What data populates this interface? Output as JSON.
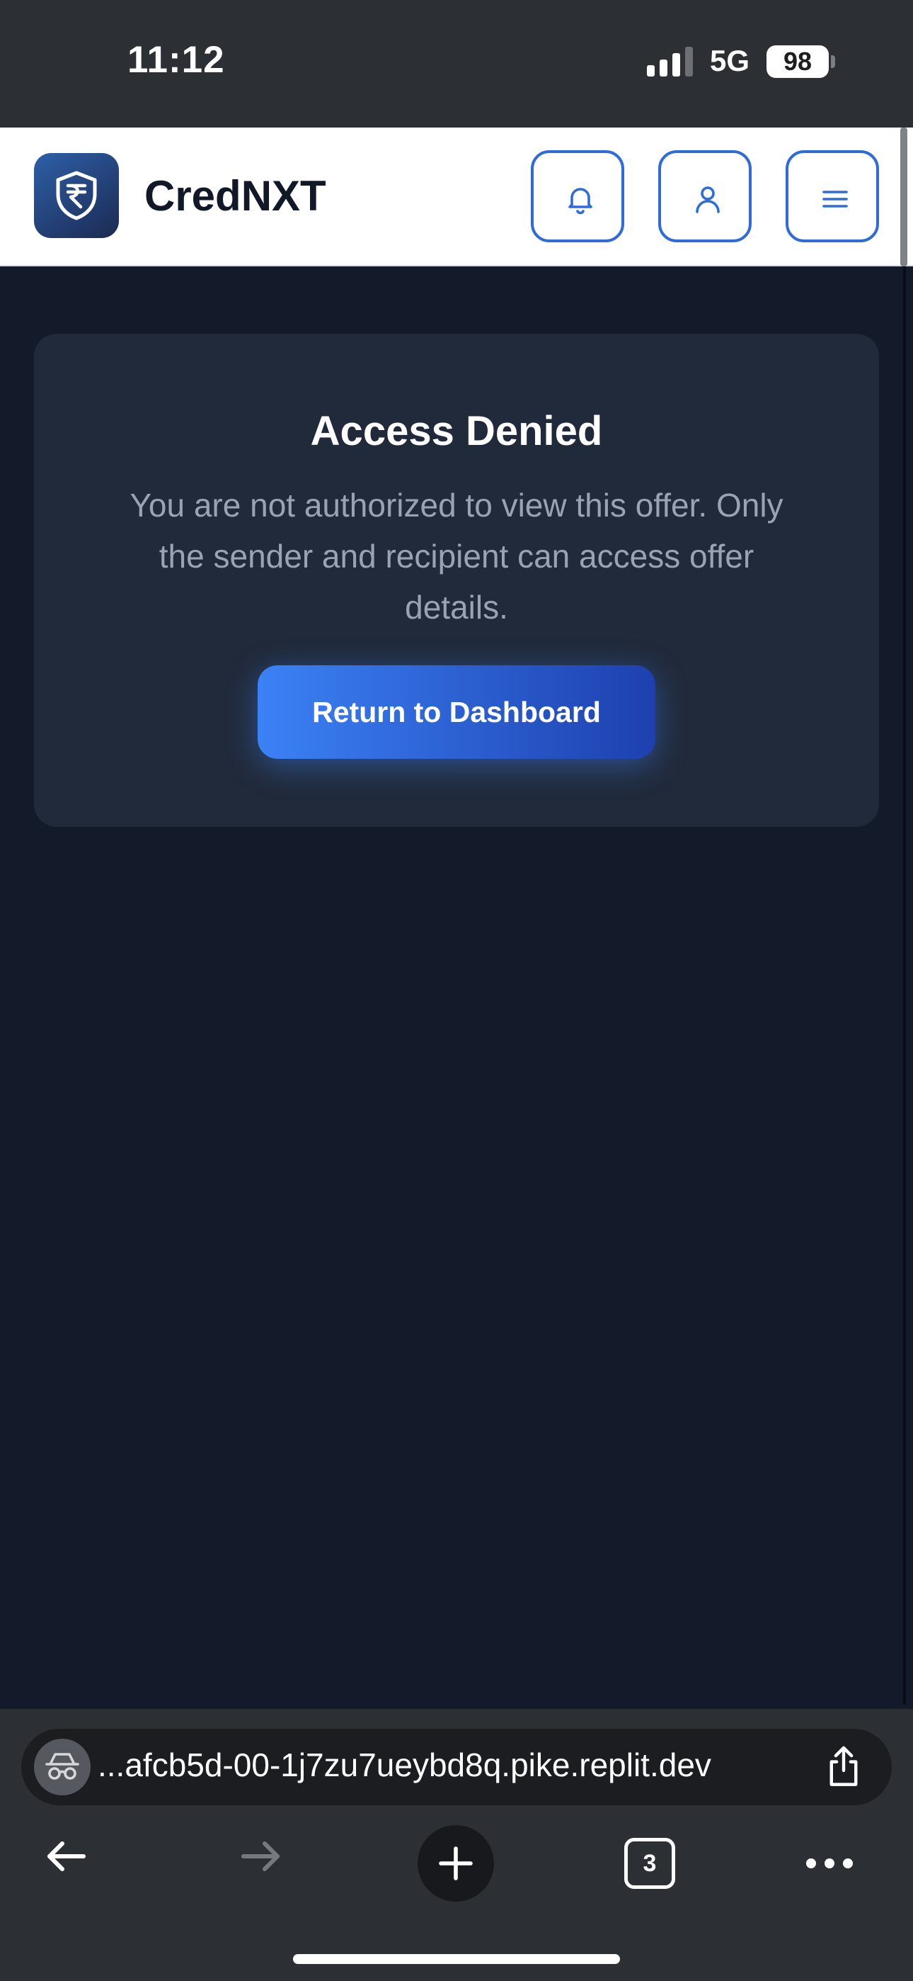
{
  "status_bar": {
    "time": "11:12",
    "network": "5G",
    "battery": "98"
  },
  "header": {
    "brand": "CredNXT",
    "logo_icon": "rupee-shield-icon",
    "buttons": [
      "bell-icon",
      "user-icon",
      "hamburger-menu-icon"
    ],
    "accent_color": "#2f6bdb"
  },
  "card": {
    "title": "Access Denied",
    "message": "You are not authorized to view this offer. Only the sender and recipient can access offer details.",
    "button_label": "Return to Dashboard",
    "button_gradient": [
      "#3b82f6",
      "#1e40af"
    ]
  },
  "browser": {
    "url": "...afcb5d-00-1j7zu7ueybd8q.pike.replit.dev",
    "tab_count": "3",
    "icons": [
      "incognito-icon",
      "share-icon",
      "back-arrow-icon",
      "forward-arrow-icon",
      "plus-icon",
      "more-dots-icon"
    ]
  },
  "colors": {
    "page_background": "#131a29",
    "card_background": "#212a3a",
    "chrome_background": "#2c2f34"
  }
}
